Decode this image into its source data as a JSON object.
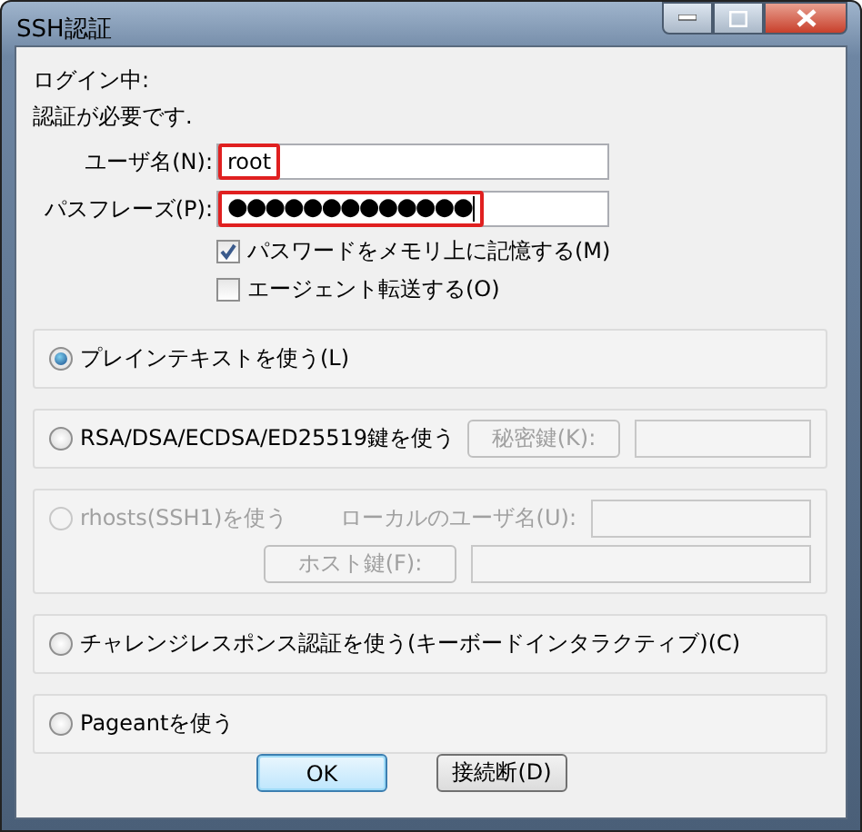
{
  "window": {
    "title": "SSH認証"
  },
  "status": [
    "ログイン中:",
    "認証が必要です."
  ],
  "fields": [
    {
      "label": "ユーザ名(N):",
      "value": "root",
      "masked": false,
      "highlighted": true
    },
    {
      "label": "パスフレーズ(P):",
      "value": "●●●●●●●●●●●●●",
      "masked": true,
      "highlighted": true
    }
  ],
  "options": [
    {
      "label": "パスワードをメモリ上に記憶する(M)",
      "checked": true
    },
    {
      "label": "エージェント転送する(O)",
      "checked": false
    }
  ],
  "methods": [
    {
      "label": "プレインテキストを使う(L)",
      "selected": true,
      "disabled": false
    },
    {
      "label": "RSA/DSA/ECDSA/ED25519鍵を使う",
      "selected": false,
      "disabled": false,
      "rows": [
        [
          {
            "kind": "button",
            "text": "秘密鍵(K):",
            "disabled": true
          },
          {
            "kind": "field",
            "disabled": true
          }
        ]
      ]
    },
    {
      "label": "rhosts(SSH1)を使う",
      "selected": false,
      "disabled": true,
      "rows": [
        [
          {
            "kind": "label",
            "text": "ローカルのユーザ名(U):",
            "disabled": true
          },
          {
            "kind": "field",
            "disabled": true
          }
        ],
        [
          {
            "kind": "button",
            "text": "ホスト鍵(F):",
            "disabled": true
          },
          {
            "kind": "field",
            "disabled": true
          }
        ]
      ]
    },
    {
      "label": "チャレンジレスポンス認証を使う(キーボードインタラクティブ)(C)",
      "selected": false,
      "disabled": false
    },
    {
      "label": "Pageantを使う",
      "selected": false,
      "disabled": false
    }
  ],
  "buttons": [
    {
      "label": "OK",
      "default": true
    },
    {
      "label": "接続断(D)",
      "default": false
    }
  ]
}
